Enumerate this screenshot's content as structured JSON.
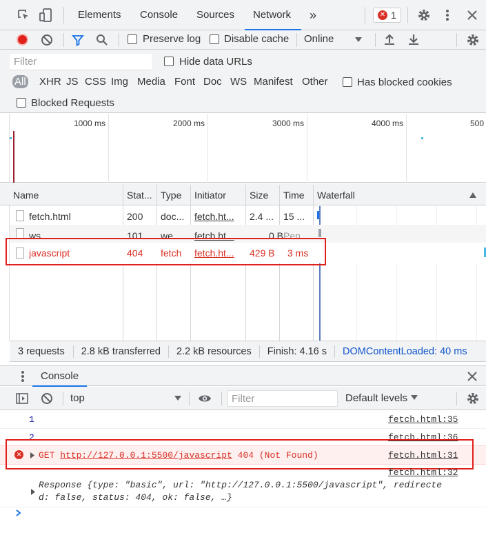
{
  "tabs": {
    "elements": "Elements",
    "console": "Console",
    "sources": "Sources",
    "network": "Network",
    "more": "»",
    "error_count": "1"
  },
  "toolbar": {
    "preserve_log": "Preserve log",
    "disable_cache": "Disable cache",
    "throttle": "Online"
  },
  "filter": {
    "placeholder": "Filter",
    "hide_data_urls": "Hide data URLs",
    "types": [
      "All",
      "XHR",
      "JS",
      "CSS",
      "Img",
      "Media",
      "Font",
      "Doc",
      "WS",
      "Manifest",
      "Other"
    ],
    "has_blocked_cookies": "Has blocked cookies",
    "blocked_requests": "Blocked Requests"
  },
  "overview": {
    "ticks": [
      "1000 ms",
      "2000 ms",
      "3000 ms",
      "4000 ms",
      "500"
    ]
  },
  "grid": {
    "headers": [
      "Name",
      "Stat...",
      "Type",
      "Initiator",
      "Size",
      "Time",
      "Waterfall"
    ],
    "rows": [
      {
        "name": "fetch.html",
        "status": "200",
        "type": "doc...",
        "initiator": "fetch.ht...",
        "size": "2.4 ...",
        "time": "15 ..."
      },
      {
        "name": "ws",
        "status": "101",
        "type": "we...",
        "initiator": "fetch.ht...",
        "size": "0 B",
        "time": "Pen..."
      },
      {
        "name": "javascript",
        "status": "404",
        "type": "fetch",
        "initiator": "fetch.ht...",
        "size": "429 B",
        "time": "3 ms"
      }
    ]
  },
  "summary": {
    "requests": "3 requests",
    "transferred": "2.8 kB transferred",
    "resources": "2.2 kB resources",
    "finish": "Finish: 4.16 s",
    "dcl": "DOMContentLoaded: 40 ms"
  },
  "drawer": {
    "title": "Console",
    "context": "top",
    "filter_placeholder": "Filter",
    "levels": "Default levels"
  },
  "console": {
    "log1_value": "1",
    "log1_source": "fetch.html:35",
    "log2_value": "2",
    "log2_source": "fetch.html:36",
    "error_method": "GET",
    "error_url": "http://127.0.0.1:5500/javascript",
    "error_status": "404 (Not Found)",
    "error_source": "fetch.html:31",
    "log3_source": "fetch.html:32",
    "response_line1": "Response {type: \"basic\", url: \"http://127.0.0.1:5500/javascript\", redirecte",
    "response_line2": "d: false, status: 404, ok: false, …}"
  },
  "colors": {
    "accent": "#1a73e8",
    "error": "#d93025",
    "highlight_box": "#e0201a",
    "link_blue": "#1155cc"
  }
}
